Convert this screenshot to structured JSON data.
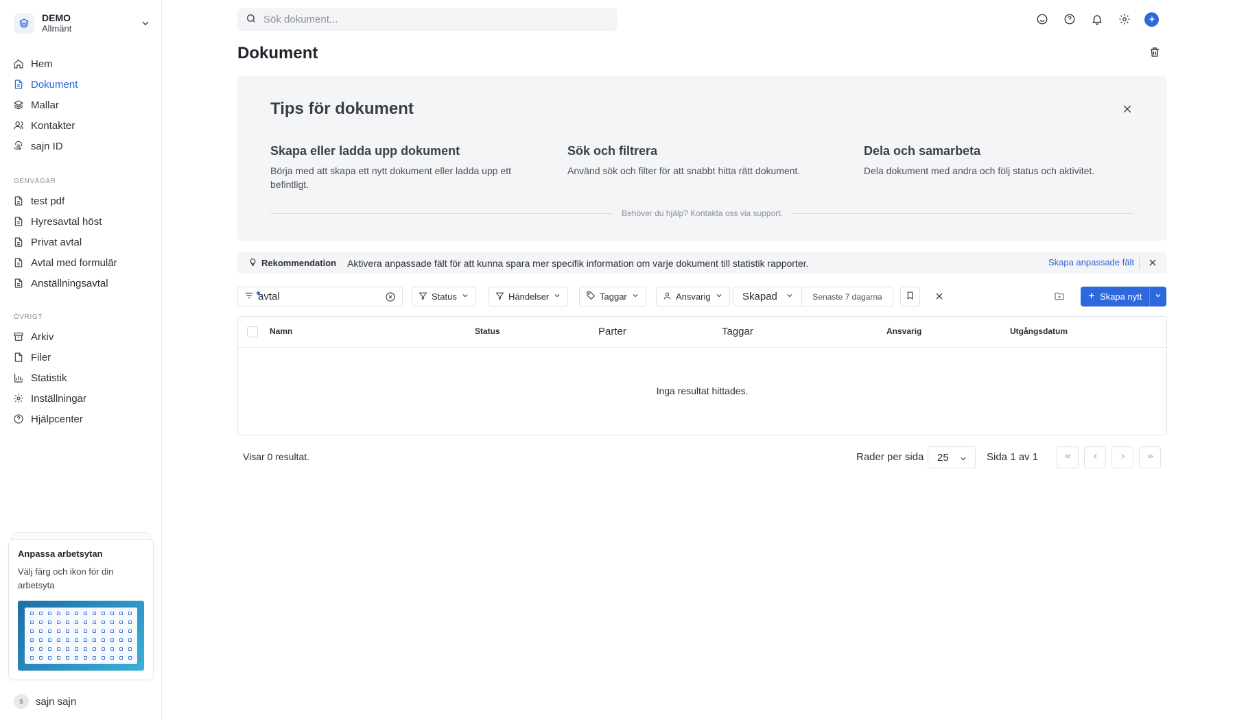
{
  "workspace": {
    "name": "DEMO",
    "subtitle": "Allmänt"
  },
  "nav": {
    "items": [
      {
        "label": "Hem",
        "icon": "home-icon"
      },
      {
        "label": "Dokument",
        "icon": "document-icon",
        "active": true
      },
      {
        "label": "Mallar",
        "icon": "layers-icon"
      },
      {
        "label": "Kontakter",
        "icon": "contacts-icon"
      },
      {
        "label": "sajn ID",
        "icon": "fingerprint-icon"
      }
    ],
    "shortcuts_heading": "GENVÄGAR",
    "shortcuts": [
      {
        "label": "test pdf"
      },
      {
        "label": "Hyresavtal höst"
      },
      {
        "label": "Privat avtal"
      },
      {
        "label": "Avtal med formulär"
      },
      {
        "label": "Anställningsavtal"
      }
    ],
    "other_heading": "ÖVRIGT",
    "other": [
      {
        "label": "Arkiv",
        "icon": "archive-icon"
      },
      {
        "label": "Filer",
        "icon": "file-icon"
      },
      {
        "label": "Statistik",
        "icon": "chart-icon"
      },
      {
        "label": "Inställningar",
        "icon": "gear-icon"
      },
      {
        "label": "Hjälpcenter",
        "icon": "help-icon"
      }
    ]
  },
  "promo": {
    "title": "Anpassa arbetsytan",
    "text": "Välj färg och ikon för din arbetsyta"
  },
  "user": {
    "initial": "s",
    "name": "sajn sajn"
  },
  "search": {
    "placeholder": "Sök dokument..."
  },
  "page": {
    "title": "Dokument"
  },
  "tips": {
    "title": "Tips för dokument",
    "items": [
      {
        "heading": "Skapa eller ladda upp dokument",
        "text": "Börja med att skapa ett nytt dokument eller ladda upp ett befintligt."
      },
      {
        "heading": "Sök och filtrera",
        "text": "Använd sök och filter för att snabbt hitta rätt dokument."
      },
      {
        "heading": "Dela och samarbeta",
        "text": "Dela dokument med andra och följ status och aktivitet."
      }
    ],
    "footer": "Behöver du hjälp? Kontakta oss via support."
  },
  "recommendation": {
    "label": "Rekommendation",
    "text": "Aktivera anpassade fält för att kunna spara mer specifik information om varje dokument till statistik rapporter.",
    "link": "Skapa anpassade fält"
  },
  "filters": {
    "query": "avtal",
    "status": "Status",
    "events": "Händelser",
    "tags": "Taggar",
    "owner": "Ansvarig",
    "created": "Skapad",
    "range": "Senaste 7 dagarna",
    "create_label": "Skapa nytt"
  },
  "table": {
    "columns": [
      "Namn",
      "Status",
      "Parter",
      "Taggar",
      "Ansvarig",
      "Utgångsdatum"
    ],
    "empty": "Inga resultat hittades."
  },
  "pagination": {
    "results": "Visar 0 resultat.",
    "rows_label": "Rader per sida",
    "rows_value": "25",
    "page_info": "Sida 1 av 1"
  },
  "colors": {
    "accent": "#2d68dd",
    "link": "#2b63d9",
    "panel": "#f4f5f6"
  }
}
